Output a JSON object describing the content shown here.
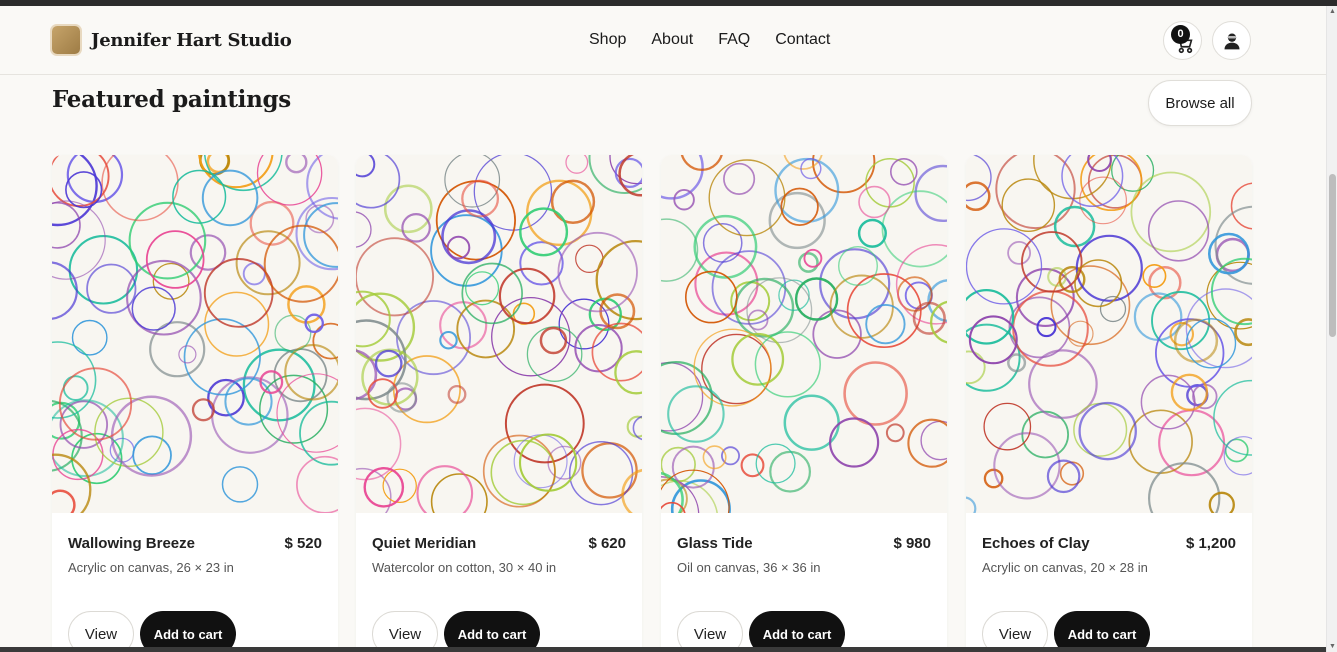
{
  "header": {
    "brand": "Jennifer Hart Studio",
    "nav": [
      "Shop",
      "About",
      "FAQ",
      "Contact"
    ],
    "cart_count": "0",
    "icons": {
      "cart": "cart-icon",
      "user": "user-icon"
    }
  },
  "section": {
    "title": "Featured paintings",
    "browse_label": "Browse all"
  },
  "products": [
    {
      "title": "Wallowing Breeze",
      "price": "$ 520",
      "medium": "Acrylic on canvas, 26 × 23 in",
      "view_label": "View",
      "cart_label": "Add to cart"
    },
    {
      "title": "Quiet Meridian",
      "price": "$ 620",
      "medium": "Watercolor on cotton, 30 × 40 in",
      "view_label": "View",
      "cart_label": "Add to cart"
    },
    {
      "title": "Glass Tide",
      "price": "$ 980",
      "medium": "Oil on canvas, 36 × 36 in",
      "view_label": "View",
      "cart_label": "Add to cart"
    },
    {
      "title": "Echoes of Clay",
      "price": "$ 1,200",
      "medium": "Acrylic on canvas, 20 × 28 in",
      "view_label": "View",
      "cart_label": "Add to cart"
    }
  ],
  "colors": {
    "background": "#faf9f6",
    "button_dark": "#111111",
    "circle_palette": [
      "#9b59b6",
      "#3498db",
      "#2ecc71",
      "#e74c3c",
      "#f39c12",
      "#1abc9c",
      "#8e44ad",
      "#d35400",
      "#27ae60",
      "#c0392b",
      "#7f8c8d",
      "#e84393",
      "#6c5ce7",
      "#a3cb38",
      "#4834d4",
      "#b8860b"
    ]
  }
}
